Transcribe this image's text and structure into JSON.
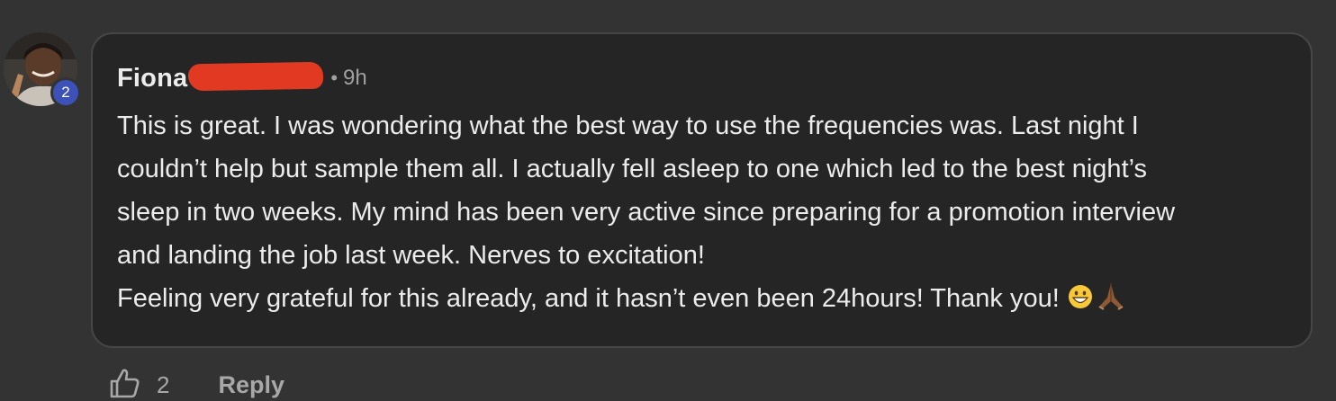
{
  "comment": {
    "author": "Fiona",
    "separator": "•",
    "timestamp": "9h",
    "avatar_level": "2",
    "body_lines": [
      "This is great. I was wondering what the best way to use the frequencies was. Last night I",
      "couldn’t help but sample them all. I actually fell asleep to one which led to the best night’s",
      "sleep in two weeks. My mind has been very active since preparing for a promotion interview",
      "and landing the job last week. Nerves to excitation!",
      "Feeling very grateful for this already, and it hasn’t even been 24hours! Thank you!"
    ],
    "emojis": [
      "grinning-face-emoji",
      "folded-hands-emoji"
    ]
  },
  "actions": {
    "like_count": "2",
    "reply_label": "Reply"
  },
  "colors": {
    "background": "#333333",
    "bubble": "#252525",
    "bubble_border": "#464646",
    "badge": "#3d52b8",
    "redaction": "#e23a22"
  }
}
